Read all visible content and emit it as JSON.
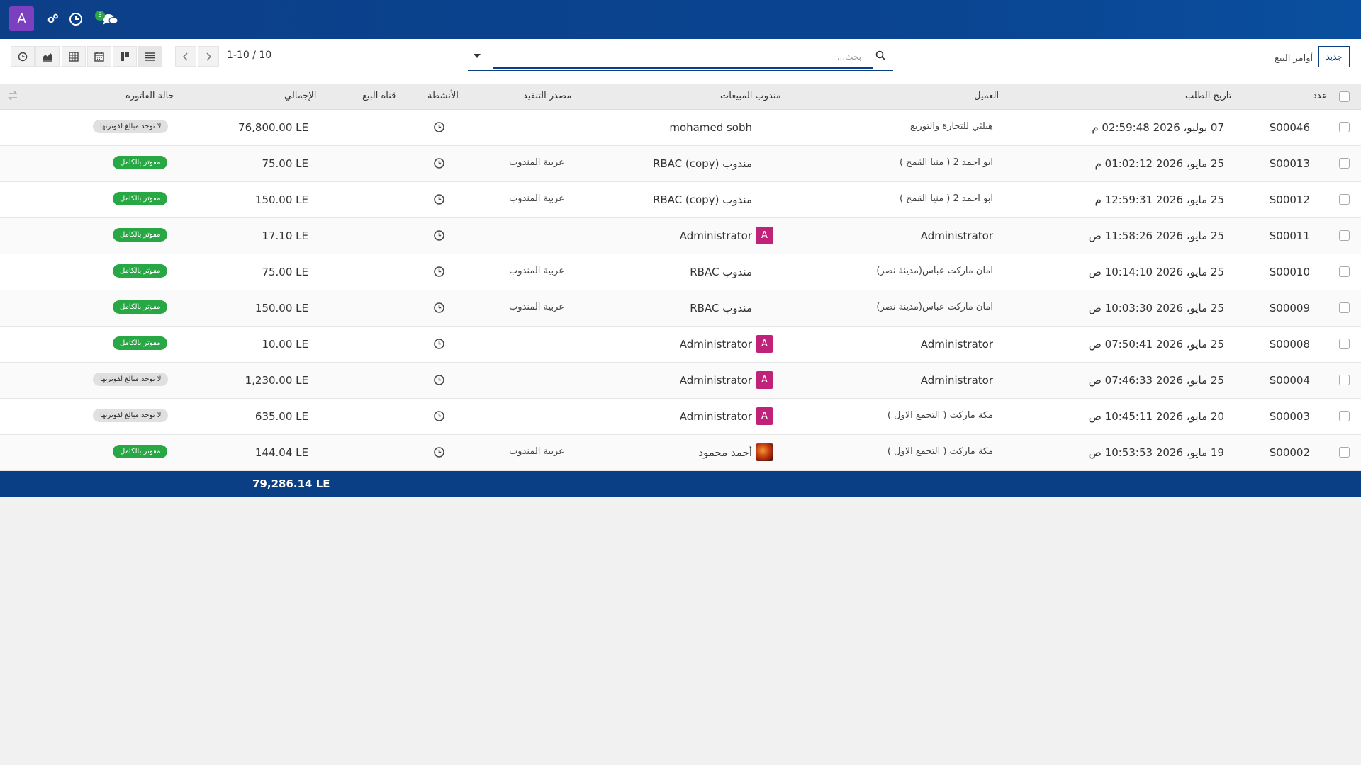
{
  "navbar": {
    "user_initial": "A",
    "message_count": "3",
    "icons": [
      "settings-cogs-icon",
      "clock-icon",
      "chat-bubbles-icon"
    ]
  },
  "control": {
    "new_button": "جديد",
    "breadcrumb": "أوامر البيع",
    "search_placeholder": "بحث...",
    "pager_value": "1-10 / 10",
    "view_icons": [
      "activity-icon",
      "graph-icon",
      "pivot-icon",
      "calendar-icon",
      "kanban-icon",
      "list-icon"
    ]
  },
  "table": {
    "headers": {
      "number": "عدد",
      "order_date": "تاريخ الطلب",
      "customer": "العميل",
      "salesperson": "مندوب المبيعات",
      "fulfillment_source": "مصدر التنفيذ",
      "activities": "الأنشطة",
      "sales_channel": "قناة البيع",
      "total": "الإجمالي",
      "invoice_status": "حالة الفاتورة"
    },
    "rows": [
      {
        "number": "S00046",
        "date": "07 يوليو، 2026 02:59:48 م",
        "customer": "هيلثي للتجارة والتوزيع",
        "salesperson": "mohamed sobh",
        "avatar": "",
        "source": "",
        "total": "76,800.00 LE",
        "status": "لا توجد مبالغ لفوترتها",
        "status_kind": "none"
      },
      {
        "number": "S00013",
        "date": "25 مايو، 2026 01:02:12 م",
        "customer": "ابو احمد 2 ( منيا القمح )",
        "salesperson": "RBAC (copy) مندوب",
        "avatar": "",
        "source": "عربية المندوب",
        "total": "75.00 LE",
        "status": "مفوتر بالكامل",
        "status_kind": "paid"
      },
      {
        "number": "S00012",
        "date": "25 مايو، 2026 12:59:31 م",
        "customer": "ابو احمد 2 ( منيا القمح )",
        "salesperson": "RBAC (copy) مندوب",
        "avatar": "",
        "source": "عربية المندوب",
        "total": "150.00 LE",
        "status": "مفوتر بالكامل",
        "status_kind": "paid"
      },
      {
        "number": "S00011",
        "date": "25 مايو، 2026 11:58:26 ص",
        "customer": "Administrator",
        "salesperson": "Administrator",
        "avatar": "A",
        "source": "",
        "total": "17.10 LE",
        "status": "مفوتر بالكامل",
        "status_kind": "paid"
      },
      {
        "number": "S00010",
        "date": "25 مايو، 2026 10:14:10 ص",
        "customer": "امان ماركت عباس(مدينة نصر)",
        "salesperson": "RBAC مندوب",
        "avatar": "",
        "source": "عربية المندوب",
        "total": "75.00 LE",
        "status": "مفوتر بالكامل",
        "status_kind": "paid"
      },
      {
        "number": "S00009",
        "date": "25 مايو، 2026 10:03:30 ص",
        "customer": "امان ماركت عباس(مدينة نصر)",
        "salesperson": "RBAC مندوب",
        "avatar": "",
        "source": "عربية المندوب",
        "total": "150.00 LE",
        "status": "مفوتر بالكامل",
        "status_kind": "paid"
      },
      {
        "number": "S00008",
        "date": "25 مايو، 2026 07:50:41 ص",
        "customer": "Administrator",
        "salesperson": "Administrator",
        "avatar": "A",
        "source": "",
        "total": "10.00 LE",
        "status": "مفوتر بالكامل",
        "status_kind": "paid"
      },
      {
        "number": "S00004",
        "date": "25 مايو، 2026 07:46:33 ص",
        "customer": "Administrator",
        "salesperson": "Administrator",
        "avatar": "A",
        "source": "",
        "total": "1,230.00 LE",
        "status": "لا توجد مبالغ لفوترتها",
        "status_kind": "none"
      },
      {
        "number": "S00003",
        "date": "20 مايو، 2026 10:45:11 ص",
        "customer": "مكة ماركت ( التجمع الاول )",
        "salesperson": "Administrator",
        "avatar": "A",
        "source": "",
        "total": "635.00 LE",
        "status": "لا توجد مبالغ لفوترتها",
        "status_kind": "none"
      },
      {
        "number": "S00002",
        "date": "19 مايو، 2026 10:53:53 ص",
        "customer": "مكة ماركت ( التجمع الاول )",
        "salesperson": "أحمد محمود",
        "avatar": "photo",
        "source": "عربية المندوب",
        "total": "144.04 LE",
        "status": "مفوتر بالكامل",
        "status_kind": "paid"
      }
    ],
    "footer_total": "79,286.14 LE"
  },
  "colors": {
    "navbar": "#0a4592",
    "accent": "#0a3f85",
    "paid_badge": "#28a745",
    "none_badge": "#e0e0e0",
    "avatar_user": "#7b3fbf",
    "avatar_sales": "#c0227a"
  }
}
